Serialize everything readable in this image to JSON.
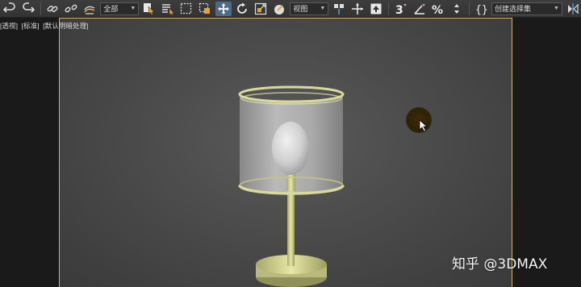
{
  "toolbar": {
    "selection_filter": "全部",
    "reference_coord": "视图",
    "named_selection_set": "创建选择集",
    "buttons": [
      {
        "name": "undo-icon"
      },
      {
        "name": "redo-icon"
      },
      {
        "name": "link-icon"
      },
      {
        "name": "unlink-icon"
      },
      {
        "name": "bind-spacewarp-icon"
      }
    ]
  },
  "viewport": {
    "labels": [
      "[透视]",
      "[标准]",
      "[默认明暗处理]"
    ]
  },
  "watermark": "知乎 @3DMAX",
  "colors": {
    "accent_active": "#4d6a87",
    "viewport_border": "#c9b36a",
    "lamp_metal": "#d8d99a",
    "shade_fill": "#c9c9c9"
  }
}
